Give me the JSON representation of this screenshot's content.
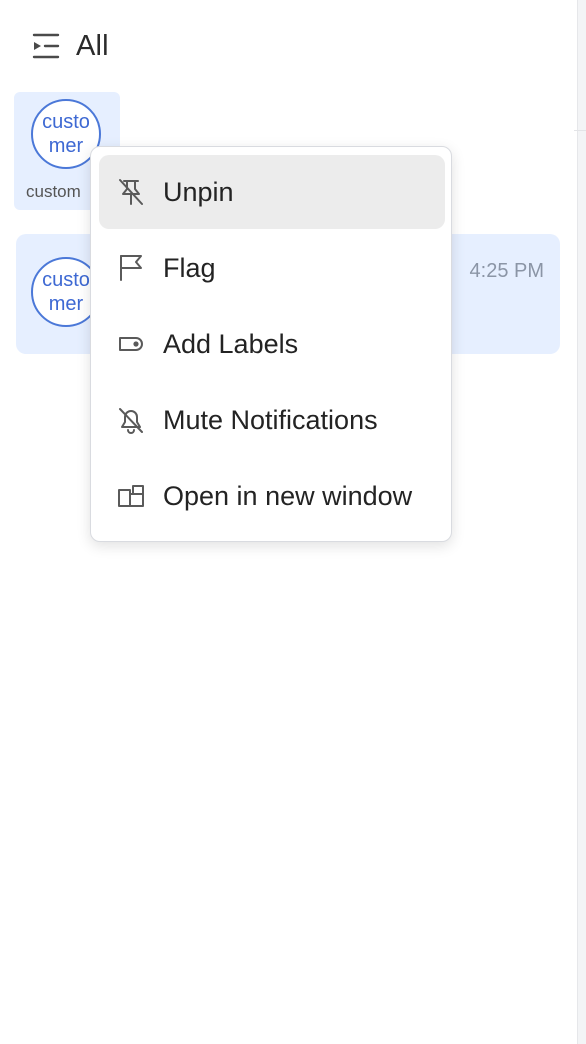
{
  "header": {
    "title": "All",
    "filter_icon": "list-filter-icon"
  },
  "pinned": {
    "avatar_text": "customer",
    "name_label": "custom"
  },
  "conversation": {
    "avatar_text": "customer",
    "time": "4:25 PM"
  },
  "context_menu": {
    "items": [
      {
        "label": "Unpin",
        "icon": "unpin-icon"
      },
      {
        "label": "Flag",
        "icon": "flag-icon"
      },
      {
        "label": "Add Labels",
        "icon": "label-icon"
      },
      {
        "label": "Mute Notifications",
        "icon": "bell-off-icon"
      },
      {
        "label": "Open in new window",
        "icon": "open-window-icon"
      }
    ]
  },
  "colors": {
    "accent": "#4b78d8",
    "highlight": "#e6efff",
    "menu_hover": "#ececec"
  }
}
